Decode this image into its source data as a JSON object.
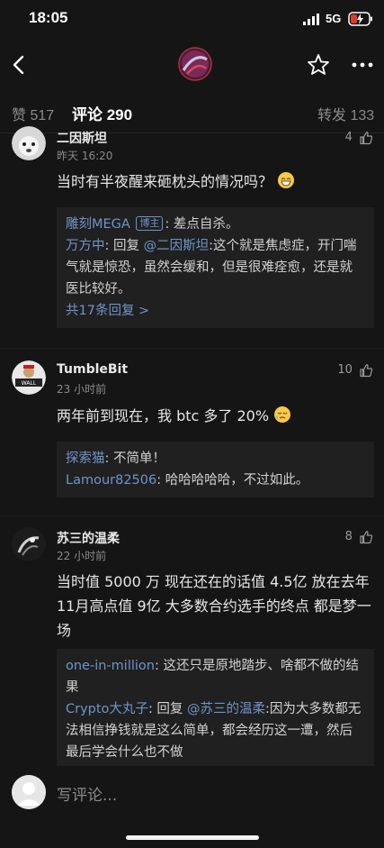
{
  "status_bar": {
    "time": "18:05",
    "network": "5G"
  },
  "tabs": {
    "likes_label": "赞 517",
    "comments_label": "评论 290",
    "reposts_label": "转发 133"
  },
  "comments": [
    {
      "user": "二因斯坦",
      "time": "昨天 16:20",
      "likes": "4",
      "text": "当时有半夜醒来砸枕头的情况吗？",
      "replies": [
        {
          "name": "雕刻MEGA",
          "tag": "博主",
          "text": ": 差点自杀。"
        },
        {
          "name": "万方中",
          "prefix": ": 回复 ",
          "mention": "@二因斯坦",
          "text": ":这个就是焦虑症，开门喘气就是惊恐，虽然会缓和，但是很难痊愈，还是就医比较好。"
        }
      ],
      "more": "共17条回复 >"
    },
    {
      "user": "TumbleBit",
      "time": "23 小时前",
      "likes": "10",
      "text": "两年前到现在，我 btc 多了 20%",
      "replies": [
        {
          "name": "探索猫",
          "text": ": 不简单！"
        },
        {
          "name": "Lamour82506",
          "text": ": 哈哈哈哈哈，不过如此。"
        }
      ]
    },
    {
      "user": "苏三的温柔",
      "time": "22 小时前",
      "likes": "8",
      "text": "当时值 5000 万 现在还在的话值 4.5亿 放在去年 11月高点值 9亿 大多数合约选手的终点 都是梦一场",
      "replies": [
        {
          "name": "one-in-million",
          "text": ": 这还只是原地踏步、啥都不做的结果"
        },
        {
          "name": "Crypto大丸子",
          "prefix": ": 回复 ",
          "mention": "@苏三的温柔",
          "text": ":因为大多数都无法相信挣钱就是这么简单，都会经历这一遭，然后最后学会什么也不做"
        }
      ]
    }
  ],
  "input": {
    "placeholder": "写评论..."
  },
  "colors": {
    "background": "#151515",
    "reply_box": "#202020",
    "link_blue": "#6f94c8",
    "tab_indicator": "#e0392b"
  }
}
